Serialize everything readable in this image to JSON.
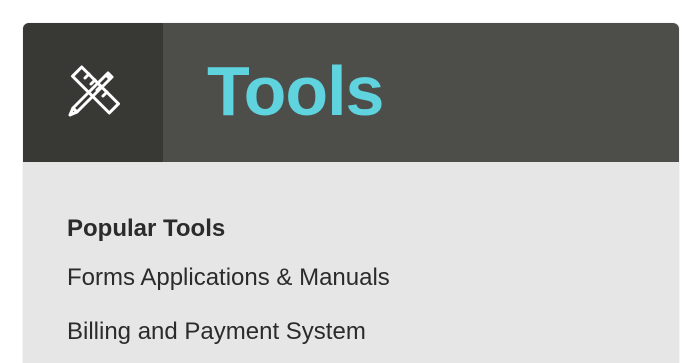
{
  "header": {
    "title": "Tools",
    "icon": "ruler-pencil-icon"
  },
  "popular_tools": {
    "heading": "Popular Tools",
    "links": [
      {
        "label": "Forms Applications & Manuals"
      },
      {
        "label": "Billing and Payment System"
      }
    ]
  },
  "colors": {
    "header_bg": "#4d4d49",
    "icon_bg": "#383835",
    "title": "#5fd3de",
    "panel_bg": "#e6e6e6",
    "text": "#2b2b2b"
  }
}
